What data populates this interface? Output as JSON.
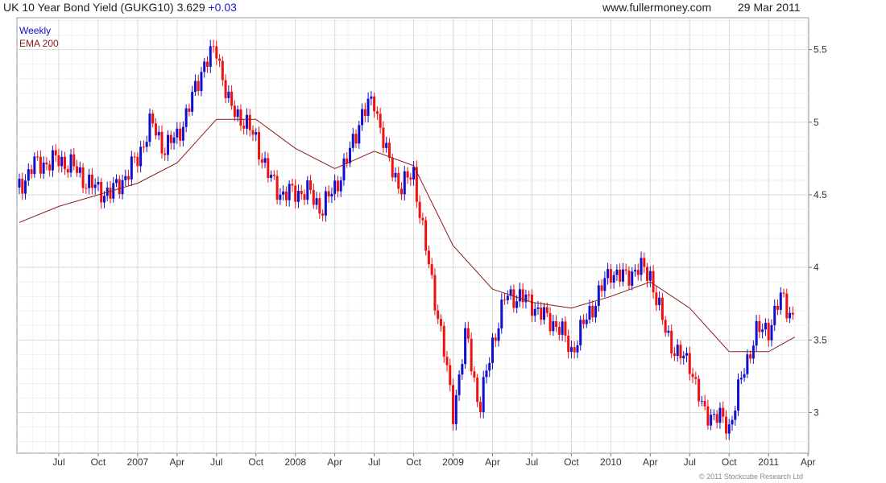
{
  "header": {
    "title": "UK 10 Year Bond Yield (GUKG10) 3.629",
    "change": "+0.03",
    "site": "www.fullermoney.com",
    "date": "29 Mar 2011"
  },
  "legend": {
    "series1": "Weekly",
    "series2": "EMA 200"
  },
  "footer": {
    "copyright": "© 2011 Stockcube Research Ltd"
  },
  "colors": {
    "up": "#1010cc",
    "down": "#ee1111",
    "ema": "#8b1a1a",
    "grid": "#d9d9d9"
  },
  "chart_data": {
    "type": "line",
    "title": "UK 10 Year Bond Yield (GUKG10)",
    "ylim": [
      2.72,
      5.72
    ],
    "y_ticks": [
      3,
      3.5,
      4,
      4.5,
      5,
      5.5
    ],
    "x_ticks": [
      "Jul",
      "Oct",
      "2007",
      "Apr",
      "Jul",
      "Oct",
      "2008",
      "Apr",
      "Jul",
      "Oct",
      "2009",
      "Apr",
      "Jul",
      "Oct",
      "2010",
      "Apr",
      "Jul",
      "Oct",
      "2011",
      "Apr"
    ],
    "grid": true,
    "legend_position": "top-left",
    "series": [
      {
        "name": "Weekly",
        "x": [
          "2006-04",
          "2006-05",
          "2006-06",
          "2006-07",
          "2006-08",
          "2006-09",
          "2006-10",
          "2006-11",
          "2006-12",
          "2007-01",
          "2007-02",
          "2007-03",
          "2007-04",
          "2007-05",
          "2007-06",
          "2007-07",
          "2007-08",
          "2007-09",
          "2007-10",
          "2007-11",
          "2007-12",
          "2008-01",
          "2008-02",
          "2008-03",
          "2008-04",
          "2008-05",
          "2008-06",
          "2008-07",
          "2008-08",
          "2008-09",
          "2008-10",
          "2008-11",
          "2008-12",
          "2009-01",
          "2009-02",
          "2009-03",
          "2009-04",
          "2009-05",
          "2009-06",
          "2009-07",
          "2009-08",
          "2009-09",
          "2009-10",
          "2009-11",
          "2009-12",
          "2010-01",
          "2010-02",
          "2010-03",
          "2010-04",
          "2010-05",
          "2010-06",
          "2010-07",
          "2010-08",
          "2010-09",
          "2010-10",
          "2010-11",
          "2010-12",
          "2011-01",
          "2011-02",
          "2011-03"
        ],
        "values": [
          4.55,
          4.7,
          4.72,
          4.74,
          4.7,
          4.6,
          4.53,
          4.51,
          4.62,
          4.75,
          5.0,
          4.82,
          4.9,
          5.12,
          5.4,
          5.5,
          5.1,
          5.02,
          4.88,
          4.62,
          4.5,
          4.52,
          4.52,
          4.4,
          4.55,
          4.75,
          5.05,
          5.15,
          4.75,
          4.55,
          4.65,
          4.08,
          3.6,
          3.0,
          3.55,
          3.02,
          3.48,
          3.8,
          3.8,
          3.75,
          3.65,
          3.6,
          3.42,
          3.62,
          3.8,
          3.98,
          3.92,
          4.0,
          3.95,
          3.6,
          3.4,
          3.35,
          3.0,
          2.98,
          2.9,
          3.25,
          3.55,
          3.58,
          3.8,
          3.63
        ]
      },
      {
        "name": "EMA 200",
        "x": [
          "2006-04",
          "2006-07",
          "2006-10",
          "2007-01",
          "2007-04",
          "2007-07",
          "2007-10",
          "2008-01",
          "2008-04",
          "2008-07",
          "2008-10",
          "2009-01",
          "2009-04",
          "2009-07",
          "2009-10",
          "2010-01",
          "2010-04",
          "2010-07",
          "2010-10",
          "2011-01",
          "2011-03"
        ],
        "values": [
          4.31,
          4.42,
          4.5,
          4.58,
          4.72,
          5.02,
          5.02,
          4.82,
          4.68,
          4.8,
          4.7,
          4.15,
          3.85,
          3.76,
          3.72,
          3.8,
          3.9,
          3.72,
          3.42,
          3.42,
          3.52
        ]
      }
    ]
  }
}
